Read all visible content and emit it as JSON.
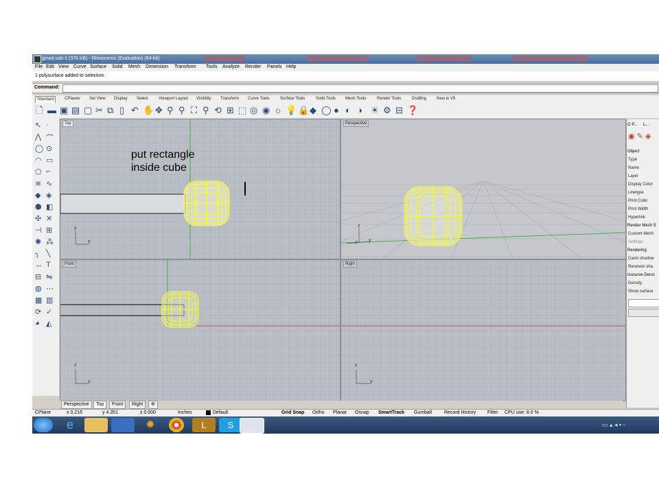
{
  "window": {
    "title": "gmod usb-1 (376 KB) - Rhinoceros (Evaluation) (64-bit)"
  },
  "menu": [
    "File",
    "Edit",
    "View",
    "Curve",
    "Surface",
    "Solid",
    "Mesh",
    "Dimension",
    "Transform",
    "Tools",
    "Analyze",
    "Render",
    "Panels",
    "Help"
  ],
  "history": "1 polysurface added to selection.",
  "command": {
    "label": "Command:",
    "value": ""
  },
  "toolbar_tabs": [
    "Standard",
    "CPlanes",
    "Set View",
    "Display",
    "Select",
    "Viewport Layout",
    "Visibility",
    "Transform",
    "Curve Tools",
    "Surface Tools",
    "Solid Tools",
    "Mesh Tools",
    "Render Tools",
    "Drafting",
    "New in V5"
  ],
  "viewports": {
    "top": "Top",
    "perspective": "Perspective",
    "front": "Front",
    "right": "Right"
  },
  "annotation": [
    "put rectangle",
    "inside cube"
  ],
  "axis_labels": {
    "x": "x",
    "y": "y",
    "z": "z"
  },
  "viewport_tabs": [
    "Perspective",
    "Top",
    "Front",
    "Right"
  ],
  "properties_panel": {
    "tabs": [
      "O P...",
      "L..."
    ],
    "sections": [
      {
        "title": "Object",
        "rows": [
          "Type",
          "Name",
          "Layer",
          "Display Color",
          "Linetype",
          "Print Color",
          "Print Width",
          "Hyperlink"
        ]
      },
      {
        "title": "Render Mesh S",
        "rows": [
          "Custom Mesh",
          "Settings"
        ]
      },
      {
        "title": "Rendering",
        "rows": [
          "Casts shadow",
          "Receives sha"
        ]
      },
      {
        "title": "Isocurve Densi",
        "rows": [
          "Density",
          "Show surface"
        ]
      }
    ]
  },
  "status": {
    "cplane": "CPlane",
    "x": "x 0.216",
    "y": "y 4.351",
    "z": "z 0.000",
    "units": "Inches",
    "layer": "Default",
    "grid_snap": "Grid Snap",
    "ortho": "Ortho",
    "planar": "Planar",
    "osnap": "Osnap",
    "smarttrack": "SmartTrack",
    "gumball": "Gumball",
    "record_history": "Record History",
    "filter": "Filter",
    "cpu": "CPU use: 8.0 %"
  },
  "colors": {
    "viewport_bg": "#b8bec4",
    "grid": "#a4aab0",
    "selected_object": "#ffff00",
    "x_axis": "#c03030",
    "y_axis": "#30a030"
  }
}
